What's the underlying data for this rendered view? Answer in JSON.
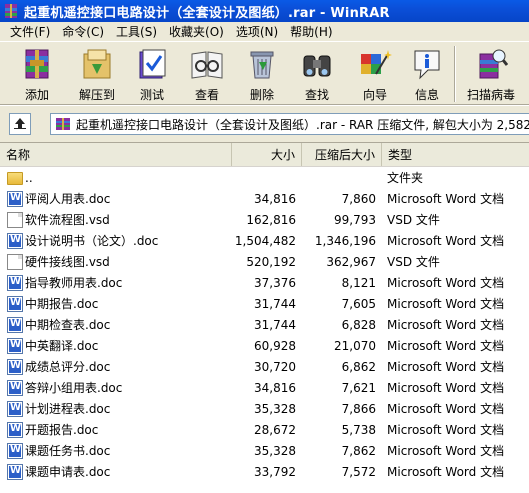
{
  "window": {
    "title": "起重机遥控接口电路设计（全套设计及图纸）.rar - WinRAR"
  },
  "menu": [
    "文件(F)",
    "命令(C)",
    "工具(S)",
    "收藏夹(O)",
    "选项(N)",
    "帮助(H)"
  ],
  "toolbar": [
    {
      "label": "添加",
      "icon": "add-archive-icon"
    },
    {
      "label": "解压到",
      "icon": "extract-to-icon"
    },
    {
      "label": "测试",
      "icon": "test-icon"
    },
    {
      "label": "查看",
      "icon": "view-icon"
    },
    {
      "label": "删除",
      "icon": "delete-icon"
    },
    {
      "label": "查找",
      "icon": "find-icon"
    },
    {
      "label": "向导",
      "icon": "wizard-icon"
    },
    {
      "label": "信息",
      "icon": "info-icon"
    },
    {
      "label": "扫描病毒",
      "icon": "virus-scan-icon"
    }
  ],
  "address": {
    "path": "起重机遥控接口电路设计（全套设计及图纸）.rar - RAR 压缩文件, 解包大小为 2,582"
  },
  "columns": {
    "name": "名称",
    "size": "大小",
    "packed": "压缩后大小",
    "type": "类型"
  },
  "files": [
    {
      "name": "..",
      "size": "",
      "packed": "",
      "type": "文件夹",
      "icon": "folder-icon"
    },
    {
      "name": "评阅人用表.doc",
      "size": "34,816",
      "packed": "7,860",
      "type": "Microsoft Word 文档",
      "icon": "word-doc-icon"
    },
    {
      "name": "软件流程图.vsd",
      "size": "162,816",
      "packed": "99,793",
      "type": "VSD 文件",
      "icon": "vsd-file-icon"
    },
    {
      "name": "设计说明书（论文）.doc",
      "size": "1,504,482",
      "packed": "1,346,196",
      "type": "Microsoft Word 文档",
      "icon": "word-doc-icon"
    },
    {
      "name": "硬件接线图.vsd",
      "size": "520,192",
      "packed": "362,967",
      "type": "VSD 文件",
      "icon": "vsd-file-icon"
    },
    {
      "name": "指导教师用表.doc",
      "size": "37,376",
      "packed": "8,121",
      "type": "Microsoft Word 文档",
      "icon": "word-doc-icon"
    },
    {
      "name": "中期报告.doc",
      "size": "31,744",
      "packed": "7,605",
      "type": "Microsoft Word 文档",
      "icon": "word-doc-icon"
    },
    {
      "name": "中期检查表.doc",
      "size": "31,744",
      "packed": "6,828",
      "type": "Microsoft Word 文档",
      "icon": "word-doc-icon"
    },
    {
      "name": "中英翻译.doc",
      "size": "60,928",
      "packed": "21,070",
      "type": "Microsoft Word 文档",
      "icon": "word-doc-icon"
    },
    {
      "name": "成绩总评分.doc",
      "size": "30,720",
      "packed": "6,862",
      "type": "Microsoft Word 文档",
      "icon": "word-doc-icon"
    },
    {
      "name": "答辩小组用表.doc",
      "size": "34,816",
      "packed": "7,621",
      "type": "Microsoft Word 文档",
      "icon": "word-doc-icon"
    },
    {
      "name": "计划进程表.doc",
      "size": "35,328",
      "packed": "7,866",
      "type": "Microsoft Word 文档",
      "icon": "word-doc-icon"
    },
    {
      "name": "开题报告.doc",
      "size": "28,672",
      "packed": "5,738",
      "type": "Microsoft Word 文档",
      "icon": "word-doc-icon"
    },
    {
      "name": "课题任务书.doc",
      "size": "35,328",
      "packed": "7,862",
      "type": "Microsoft Word 文档",
      "icon": "word-doc-icon"
    },
    {
      "name": "课题申请表.doc",
      "size": "33,792",
      "packed": "7,572",
      "type": "Microsoft Word 文档",
      "icon": "word-doc-icon"
    }
  ]
}
